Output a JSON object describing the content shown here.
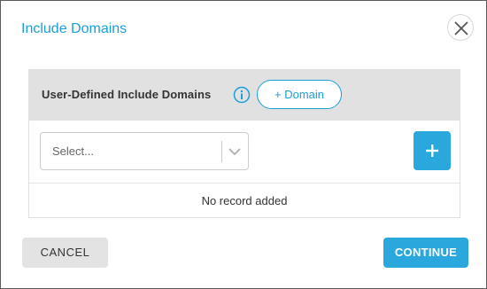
{
  "dialog": {
    "title": "Include Domains",
    "close_icon": "close-icon"
  },
  "panel": {
    "header_label": "User-Defined Include Domains",
    "info_icon": "info-icon",
    "add_domain_label": "+ Domain",
    "select_placeholder": "Select...",
    "select_chevron_icon": "chevron-down-icon",
    "add_icon": "plus-icon",
    "empty_message": "No record added"
  },
  "footer": {
    "cancel_label": "CANCEL",
    "continue_label": "CONTINUE"
  },
  "colors": {
    "accent": "#1a9fd9",
    "button_primary": "#2aa7dc",
    "header_bg": "#e1e1e1",
    "secondary_button_bg": "#e3e3e3"
  }
}
